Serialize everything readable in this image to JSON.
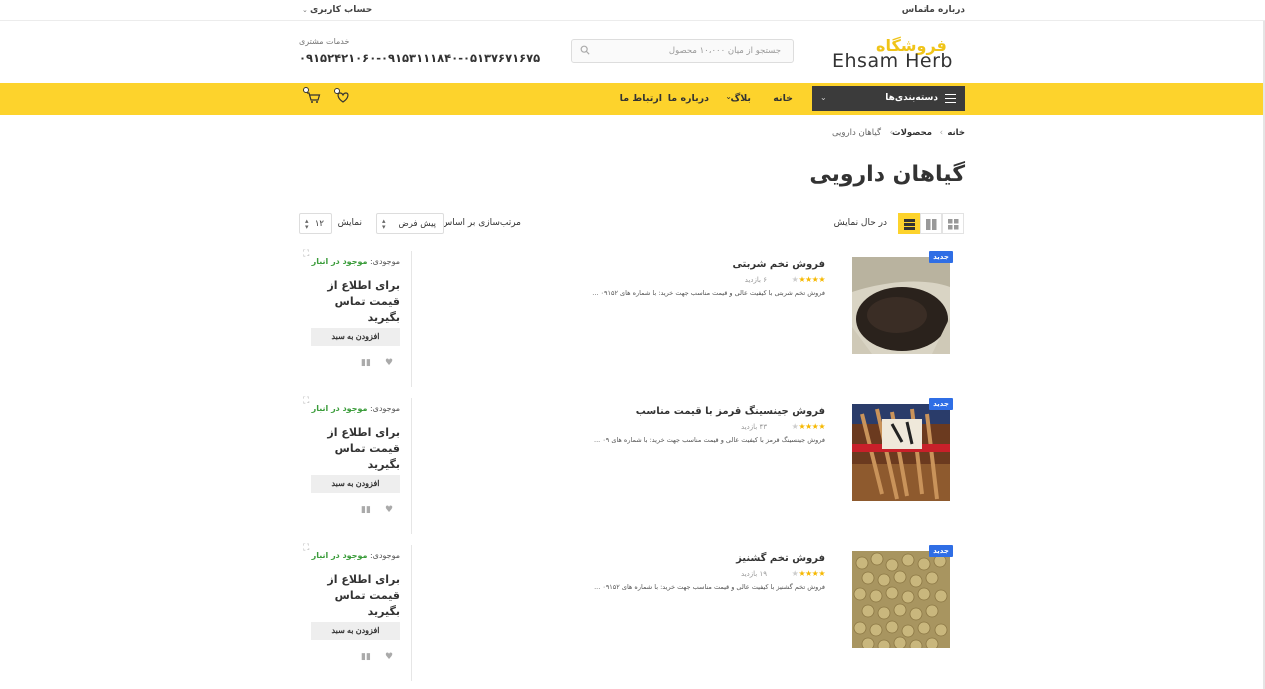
{
  "topbar": {
    "about": "درباره ما",
    "contact": "تماس",
    "account": "حساب کاربری"
  },
  "header": {
    "logo_fa": "فروشگاه",
    "logo_en": "Ehsam Herb",
    "search_placeholder": "جستجو از میان ۱۰،۰۰۰ محصول",
    "customer_service_label": "خدمات مشتری",
    "phones": "۰۹۱۵۲۴۲۱۰۶۰-۰۹۱۵۳۱۱۱۸۴۰-۰۵۱۳۷۶۷۱۶۷۵"
  },
  "nav": {
    "categories": "دسته‌بندی‌ها",
    "items": [
      "خانه",
      "بلاگ",
      "درباره ما",
      "ارتباط ما"
    ]
  },
  "breadcrumb": [
    "خانه",
    "محصولات",
    "گیاهان دارویی"
  ],
  "page_title": "گیاهان دارویی",
  "toolbar": {
    "view_label": "در حال نمایش",
    "sort_label": "مرتب‌سازی بر اساس",
    "sort_value": "پیش فرض",
    "show_label": "نمایش",
    "show_value": "۱۲"
  },
  "products": [
    {
      "badge": "جدید",
      "title": "فروش تخم شربتی",
      "rating": 4,
      "views": "۶ بازدید",
      "desc": "فروش تخم شربتی با کیفیت عالی و قیمت مناسب جهت خرید: با شماره های ۰۹۱۵۲ ...",
      "stock_label": "موجودی:",
      "stock_value": "موجود در انبار",
      "price": "برای اطلاع از قیمت تماس بگیرید",
      "add_to_cart": "افزودن به سبد"
    },
    {
      "badge": "جدید",
      "title": "فروش جینسینگ قرمز با قیمت مناسب",
      "rating": 4,
      "views": "۴۳ بازدید",
      "desc": "فروش جینسینگ قرمز با کیفیت عالی و قیمت مناسب جهت خرید: با شماره های ۰۹ ...",
      "stock_label": "موجودی:",
      "stock_value": "موجود در انبار",
      "price": "برای اطلاع از قیمت تماس بگیرید",
      "add_to_cart": "افزودن به سبد"
    },
    {
      "badge": "جدید",
      "title": "فروش تخم گشنیز",
      "rating": 4,
      "views": "۱۹ بازدید",
      "desc": "فروش تخم گشنیز با کیفیت عالی و قیمت مناسب جهت خرید: با شماره های ۰۹۱۵۲ ...",
      "stock_label": "موجودی:",
      "stock_value": "موجود در انبار",
      "price": "برای اطلاع از قیمت تماس بگیرید",
      "add_to_cart": "افزودن به سبد"
    }
  ],
  "colors": {
    "accent": "#fdd32c",
    "dark": "#3b3b3b",
    "badge": "#2f6ee5",
    "in_stock": "#3a9c3a"
  }
}
